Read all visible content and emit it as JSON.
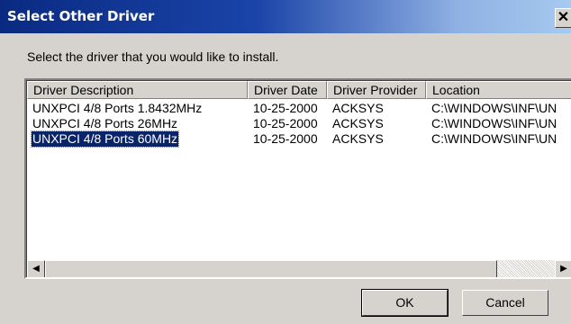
{
  "window": {
    "title": "Select Other Driver",
    "close_glyph": "✕"
  },
  "instruction": "Select the driver that you would like to install.",
  "list": {
    "columns": [
      "Driver Description",
      "Driver Date",
      "Driver Provider",
      "Location"
    ],
    "rows": [
      {
        "description": "UNXPCI 4/8 Ports 1.8432MHz",
        "date": "10-25-2000",
        "provider": "ACKSYS",
        "location": "C:\\WINDOWS\\INF\\UN"
      },
      {
        "description": "UNXPCI 4/8 Ports 26MHz",
        "date": "10-25-2000",
        "provider": "ACKSYS",
        "location": "C:\\WINDOWS\\INF\\UN"
      },
      {
        "description": "UNXPCI 4/8 Ports 60MHz",
        "date": "10-25-2000",
        "provider": "ACKSYS",
        "location": "C:\\WINDOWS\\INF\\UN",
        "selected": true
      }
    ],
    "scroll_left_glyph": "◀",
    "scroll_right_glyph": "▶"
  },
  "buttons": {
    "ok": "OK",
    "cancel": "Cancel"
  },
  "colors": {
    "selection": "#0a246a",
    "titlebar_start": "#0a2a82",
    "titlebar_end": "#a6caf0",
    "face": "#d6d3ce"
  }
}
